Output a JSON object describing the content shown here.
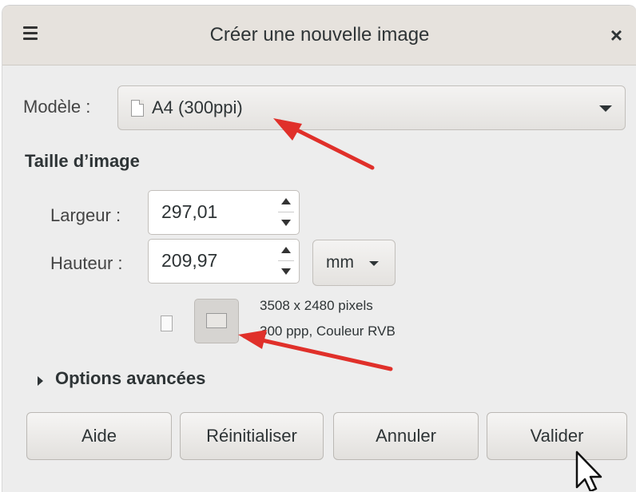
{
  "window": {
    "title": "Créer une nouvelle image",
    "close_glyph": "×"
  },
  "template": {
    "label": "Modèle :",
    "value": "A4 (300ppi)"
  },
  "image_size": {
    "heading": "Taille d’image",
    "width_label": "Largeur :",
    "width_value": "297,01",
    "height_label": "Hauteur :",
    "height_value": "209,97",
    "unit": "mm"
  },
  "info": {
    "pixels": "3508 x 2480 pixels",
    "resolution": "300 ppp, Couleur RVB"
  },
  "advanced": {
    "label": "Options avancées"
  },
  "buttons": {
    "help": "Aide",
    "reset": "Réinitialiser",
    "cancel": "Annuler",
    "ok": "Valider"
  },
  "colors": {
    "annotation_arrow": "#e0302a",
    "dialog_bg": "#ededed",
    "titlebar_bg": "#e6e2dd"
  },
  "icons": [
    "menu-icon",
    "close-icon",
    "document-icon",
    "portrait-icon",
    "landscape-icon",
    "expander-arrow-icon",
    "mouse-cursor-icon"
  ]
}
